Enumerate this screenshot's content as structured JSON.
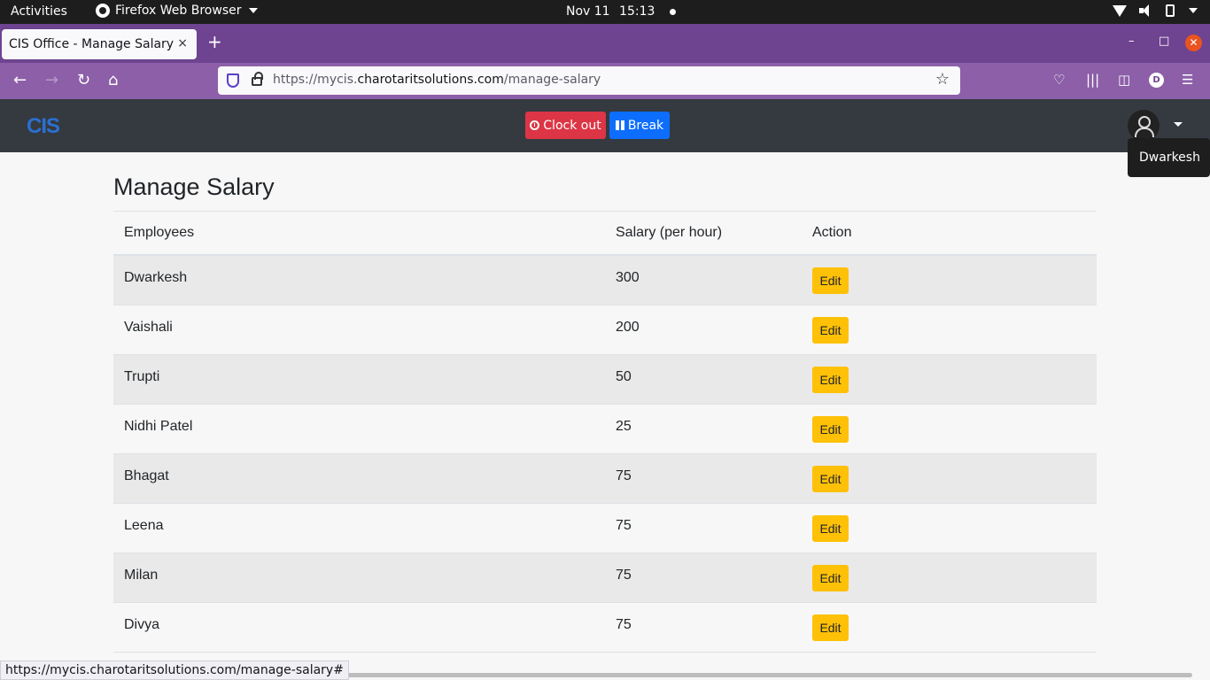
{
  "system": {
    "activities": "Activities",
    "app_name": "Firefox Web Browser",
    "date": "Nov 11",
    "time": "15:13"
  },
  "browser": {
    "tab_title": "CIS Office - Manage Salary",
    "tab_close": "×",
    "new_tab": "+",
    "url_prefix": "https://mycis.",
    "url_domain": "charotaritsolutions.com",
    "url_path": "/manage-salary",
    "profile_initial": "D",
    "status_url": "https://mycis.charotaritsolutions.com/manage-salary#"
  },
  "app": {
    "logo": "CIS",
    "clock_out_label": "Clock out",
    "break_label": "Break",
    "user_name": "Dwarkesh"
  },
  "page": {
    "title": "Manage Salary",
    "columns": [
      "Employees",
      "Salary (per hour)",
      "Action"
    ],
    "rows": [
      {
        "name": "Dwarkesh",
        "salary": "300",
        "action": "Edit"
      },
      {
        "name": "Vaishali",
        "salary": "200",
        "action": "Edit"
      },
      {
        "name": "Trupti",
        "salary": "50",
        "action": "Edit"
      },
      {
        "name": "Nidhi Patel",
        "salary": "25",
        "action": "Edit"
      },
      {
        "name": "Bhagat",
        "salary": "75",
        "action": "Edit"
      },
      {
        "name": "Leena",
        "salary": "75",
        "action": "Edit"
      },
      {
        "name": "Milan",
        "salary": "75",
        "action": "Edit"
      },
      {
        "name": "Divya",
        "salary": "75",
        "action": "Edit"
      }
    ]
  },
  "colors": {
    "tab_strip": "#6e4390",
    "nav_bar": "#8c5fa8",
    "app_header": "#343a40",
    "clock_out": "#dc3545",
    "break": "#0d6efd",
    "edit": "#ffc107"
  }
}
